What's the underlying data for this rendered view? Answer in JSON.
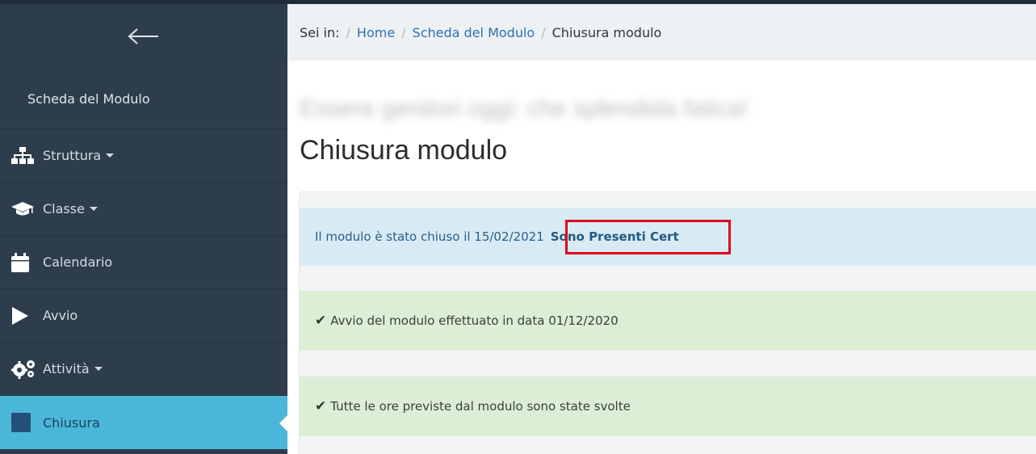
{
  "sidebar": {
    "back_label": "",
    "title": "Scheda del Modulo",
    "items": [
      {
        "label": "Struttura",
        "icon": "sitemap-icon",
        "has_caret": true
      },
      {
        "label": "Classe",
        "icon": "graduation-cap-icon",
        "has_caret": true
      },
      {
        "label": "Calendario",
        "icon": "calendar-icon",
        "has_caret": false
      },
      {
        "label": "Avvio",
        "icon": "play-icon",
        "has_caret": false
      },
      {
        "label": "Attività",
        "icon": "gears-icon",
        "has_caret": true
      },
      {
        "label": "Chiusura",
        "icon": "square-icon",
        "has_caret": false,
        "active": true
      }
    ]
  },
  "breadcrumb": {
    "prefix": "Sei in:",
    "items": [
      "Home",
      "Scheda del Modulo",
      "Chiusura modulo"
    ]
  },
  "main": {
    "blurred_title": "Essere genitori oggi: che splendida fatica!",
    "title": "Chiusura modulo",
    "alerts": {
      "closed_text": "Il modulo è stato chiuso il 15/02/2021",
      "closed_link": "Sono Presenti Cert",
      "start_text": "Avvio del modulo effettuato in data 01/12/2020",
      "hours_text": "Tutte le ore previste dal modulo sono state svolte"
    }
  },
  "colors": {
    "sidebar_bg": "#2e3d4c",
    "active_item": "#4ab7d9",
    "info_alert": "#d8ebf5",
    "success_alert": "#dcefd6",
    "highlight": "#e3001b"
  }
}
